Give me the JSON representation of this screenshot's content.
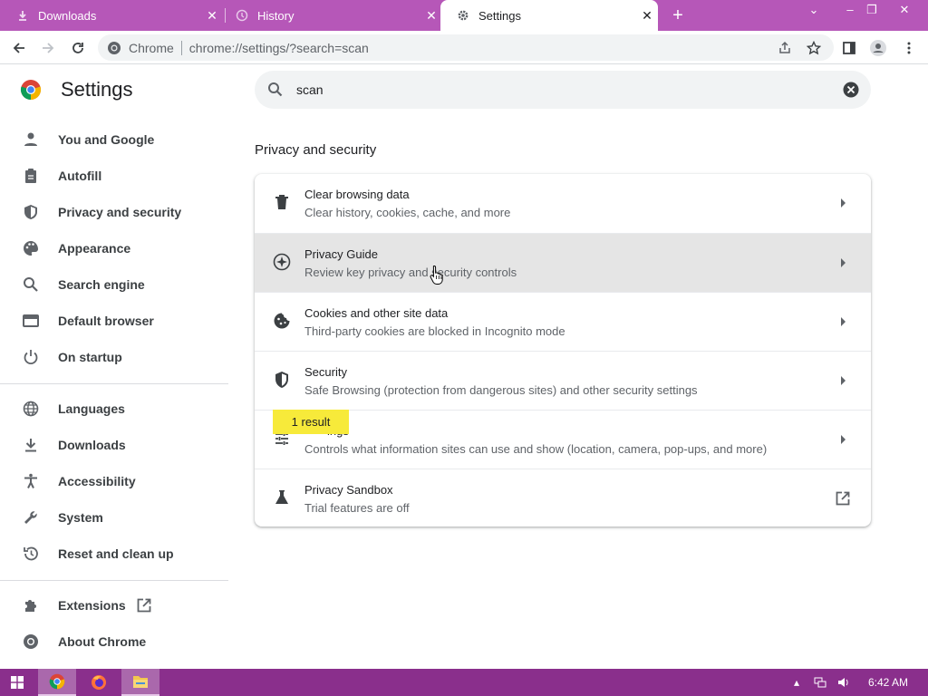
{
  "tabs": [
    {
      "label": "Downloads",
      "icon": "download-icon"
    },
    {
      "label": "History",
      "icon": "history-icon"
    },
    {
      "label": "Settings",
      "icon": "gear-icon",
      "active": true
    }
  ],
  "tab_close_glyph": "✕",
  "new_tab_glyph": "+",
  "window_controls": {
    "dropdown": "⌄",
    "minimize": "–",
    "restore": "❐",
    "close": "✕"
  },
  "omnibox": {
    "site_label": "Chrome",
    "url": "chrome://settings/?search=scan"
  },
  "sidebar": {
    "title": "Settings",
    "items": [
      {
        "label": "You and Google",
        "icon": "person-icon"
      },
      {
        "label": "Autofill",
        "icon": "clipboard-icon"
      },
      {
        "label": "Privacy and security",
        "icon": "shield-icon"
      },
      {
        "label": "Appearance",
        "icon": "palette-icon"
      },
      {
        "label": "Search engine",
        "icon": "search-icon"
      },
      {
        "label": "Default browser",
        "icon": "browser-icon"
      },
      {
        "label": "On startup",
        "icon": "power-icon"
      },
      {
        "label": "Languages",
        "icon": "globe-icon"
      },
      {
        "label": "Downloads",
        "icon": "download-icon"
      },
      {
        "label": "Accessibility",
        "icon": "accessibility-icon"
      },
      {
        "label": "System",
        "icon": "wrench-icon"
      },
      {
        "label": "Reset and clean up",
        "icon": "restore-icon"
      },
      {
        "label": "Extensions",
        "icon": "puzzle-icon"
      },
      {
        "label": "About Chrome",
        "icon": "chrome-icon"
      }
    ]
  },
  "search": {
    "value": "scan"
  },
  "section_title": "Privacy and security",
  "rows": [
    {
      "title": "Clear browsing data",
      "subtitle": "Clear history, cookies, cache, and more",
      "icon": "trash-icon"
    },
    {
      "title": "Privacy Guide",
      "subtitle": "Review key privacy and security controls",
      "icon": "compass-icon"
    },
    {
      "title": "Cookies and other site data",
      "subtitle": "Third-party cookies are blocked in Incognito mode",
      "icon": "cookie-icon"
    },
    {
      "title": "Security",
      "subtitle": "Safe Browsing (protection from dangerous sites) and other security settings",
      "icon": "shield-icon"
    },
    {
      "title": "ings",
      "subtitle": "Controls what information sites can use and show (location, camera, pop-ups, and more)",
      "icon": "tune-icon"
    },
    {
      "title": "Privacy Sandbox",
      "subtitle": "Trial features are off",
      "icon": "flask-icon"
    }
  ],
  "search_bubble": "1 result",
  "taskbar": {
    "time": "6:42 AM"
  },
  "colors": {
    "titlebar": "#b657b8",
    "taskbar": "#8a2f8c",
    "highlight": "#f7ea3a"
  }
}
